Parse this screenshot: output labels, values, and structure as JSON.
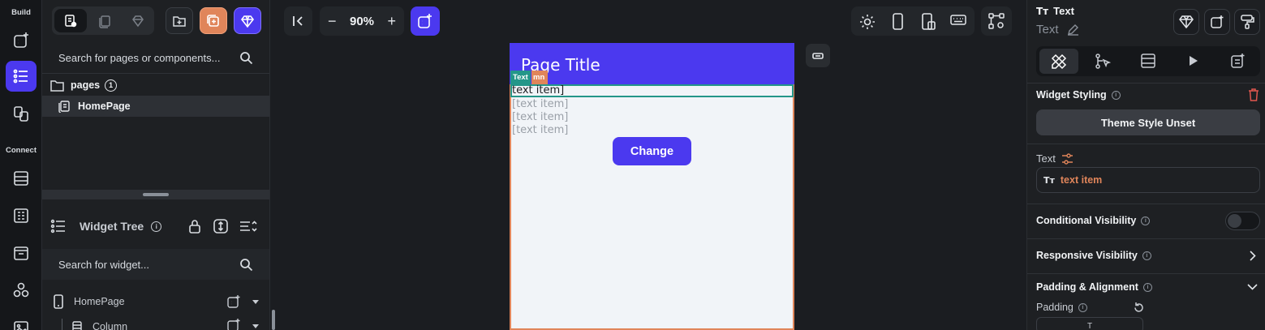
{
  "rail": {
    "build_label": "Build",
    "connect_label": "Connect"
  },
  "left_panel": {
    "page_search_placeholder": "Search for pages or components...",
    "folder_label": "pages",
    "folder_count": "1",
    "page_item": "HomePage",
    "widget_tree_title": "Widget Tree",
    "widget_search_placeholder": "Search for widget...",
    "tree": [
      {
        "label": "HomePage"
      },
      {
        "label": "Column"
      }
    ]
  },
  "toolbar": {
    "zoom": "90%"
  },
  "phone": {
    "page_title": "Page Title",
    "tag_text": "Text",
    "tag_column": "mn",
    "items": [
      "text item]",
      "[text item]",
      "[text item]",
      "[text item]"
    ],
    "button_label": "Change"
  },
  "right_panel": {
    "widget_type": "Text",
    "widget_name": "Text",
    "widget_styling": "Widget Styling",
    "theme_style_button": "Theme Style Unset",
    "text_label": "Text",
    "text_value": "text item",
    "conditional_visibility": "Conditional Visibility",
    "responsive_visibility": "Responsive Visibility",
    "padding_alignment": "Padding & Alignment",
    "padding_label": "Padding",
    "padding_top_label": "T"
  },
  "colors": {
    "accent": "#4b39ef",
    "orange": "#e0855a",
    "teal": "#249689",
    "danger": "#e0574f"
  }
}
